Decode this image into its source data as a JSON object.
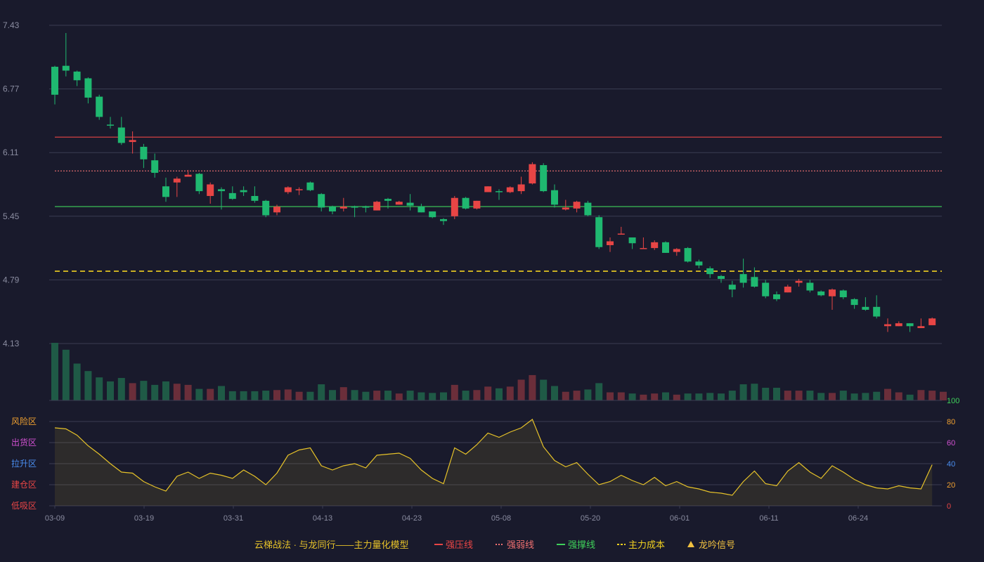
{
  "chart_data": {
    "type": "candlestick",
    "x_labels": [
      "03-09",
      "03-19",
      "03-31",
      "04-13",
      "04-23",
      "05-08",
      "05-20",
      "06-01",
      "06-11",
      "06-24"
    ],
    "price_axis": {
      "ticks": [
        "7.43",
        "6.77",
        "6.11",
        "5.45",
        "4.79",
        "4.13"
      ],
      "range": [
        4.13,
        7.43
      ]
    },
    "levels": [
      {
        "name": "强压线",
        "value": 6.27,
        "color": "#e84545",
        "style": "solid"
      },
      {
        "name": "强弱线",
        "value": 5.92,
        "color": "#f07070",
        "style": "dotted"
      },
      {
        "name": "强撑线",
        "value": 5.55,
        "color": "#3fd15a",
        "style": "solid"
      },
      {
        "name": "主力成本",
        "value": 4.88,
        "color": "#f0d020",
        "style": "dashed"
      }
    ],
    "candles": [
      [
        7.0,
        6.71,
        7.01,
        6.61
      ],
      [
        7.01,
        6.96,
        7.35,
        6.9
      ],
      [
        6.95,
        6.86,
        6.96,
        6.8
      ],
      [
        6.88,
        6.68,
        6.89,
        6.62
      ],
      [
        6.69,
        6.48,
        6.71,
        6.45
      ],
      [
        6.4,
        6.39,
        6.48,
        6.36
      ],
      [
        6.37,
        6.21,
        6.48,
        6.19
      ],
      [
        6.22,
        6.24,
        6.33,
        6.1
      ],
      [
        6.17,
        6.04,
        6.2,
        5.95
      ],
      [
        6.03,
        5.9,
        6.1,
        5.85
      ],
      [
        5.76,
        5.65,
        5.85,
        5.6
      ],
      [
        5.8,
        5.84,
        5.86,
        5.65
      ],
      [
        5.86,
        5.88,
        5.93,
        5.86
      ],
      [
        5.89,
        5.71,
        5.9,
        5.68
      ],
      [
        5.66,
        5.78,
        5.8,
        5.58
      ],
      [
        5.73,
        5.71,
        5.75,
        5.52
      ],
      [
        5.69,
        5.63,
        5.76,
        5.62
      ],
      [
        5.72,
        5.7,
        5.76,
        5.66
      ],
      [
        5.66,
        5.61,
        5.76,
        5.59
      ],
      [
        5.61,
        5.46,
        5.62,
        5.44
      ],
      [
        5.49,
        5.55,
        5.57,
        5.46
      ],
      [
        5.7,
        5.75,
        5.76,
        5.68
      ],
      [
        5.72,
        5.73,
        5.75,
        5.67
      ],
      [
        5.8,
        5.72,
        5.81,
        5.71
      ],
      [
        5.68,
        5.54,
        5.69,
        5.5
      ],
      [
        5.55,
        5.5,
        5.56,
        5.47
      ],
      [
        5.53,
        5.55,
        5.64,
        5.5
      ],
      [
        5.55,
        5.54,
        5.56,
        5.44
      ],
      [
        5.55,
        5.54,
        5.56,
        5.49
      ],
      [
        5.51,
        5.6,
        5.61,
        5.51
      ],
      [
        5.63,
        5.61,
        5.64,
        5.53
      ],
      [
        5.57,
        5.6,
        5.61,
        5.57
      ],
      [
        5.59,
        5.56,
        5.68,
        5.51
      ],
      [
        5.55,
        5.49,
        5.58,
        5.49
      ],
      [
        5.5,
        5.44,
        5.5,
        5.43
      ],
      [
        5.42,
        5.4,
        5.43,
        5.36
      ],
      [
        5.45,
        5.64,
        5.66,
        5.42
      ],
      [
        5.64,
        5.53,
        5.65,
        5.52
      ],
      [
        5.53,
        5.61,
        5.61,
        5.52
      ],
      [
        5.7,
        5.76,
        5.76,
        5.7
      ],
      [
        5.71,
        5.7,
        5.73,
        5.62
      ],
      [
        5.7,
        5.75,
        5.76,
        5.69
      ],
      [
        5.71,
        5.78,
        5.86,
        5.68
      ],
      [
        5.79,
        5.99,
        6.01,
        5.78
      ],
      [
        5.98,
        5.71,
        6.0,
        5.7
      ],
      [
        5.72,
        5.57,
        5.78,
        5.54
      ],
      [
        5.52,
        5.54,
        5.62,
        5.51
      ],
      [
        5.53,
        5.6,
        5.61,
        5.49
      ],
      [
        5.59,
        5.46,
        5.61,
        5.45
      ],
      [
        5.44,
        5.13,
        5.46,
        5.11
      ],
      [
        5.15,
        5.19,
        5.23,
        5.08
      ],
      [
        5.27,
        5.27,
        5.34,
        5.26
      ],
      [
        5.23,
        5.17,
        5.23,
        5.11
      ],
      [
        5.12,
        5.12,
        5.23,
        5.12
      ],
      [
        5.12,
        5.18,
        5.2,
        5.1
      ],
      [
        5.18,
        5.07,
        5.19,
        5.07
      ],
      [
        5.08,
        5.11,
        5.12,
        5.04
      ],
      [
        5.12,
        4.98,
        5.13,
        4.97
      ],
      [
        4.98,
        4.94,
        5.0,
        4.91
      ],
      [
        4.91,
        4.85,
        4.93,
        4.81
      ],
      [
        4.83,
        4.8,
        4.84,
        4.76
      ],
      [
        4.74,
        4.69,
        4.78,
        4.61
      ],
      [
        4.85,
        4.76,
        5.01,
        4.71
      ],
      [
        4.82,
        4.72,
        4.92,
        4.71
      ],
      [
        4.76,
        4.62,
        4.79,
        4.6
      ],
      [
        4.64,
        4.59,
        4.67,
        4.57
      ],
      [
        4.66,
        4.72,
        4.74,
        4.66
      ],
      [
        4.76,
        4.78,
        4.8,
        4.72
      ],
      [
        4.76,
        4.68,
        4.79,
        4.66
      ],
      [
        4.67,
        4.63,
        4.68,
        4.62
      ],
      [
        4.62,
        4.69,
        4.7,
        4.48
      ],
      [
        4.68,
        4.61,
        4.69,
        4.59
      ],
      [
        4.59,
        4.53,
        4.6,
        4.49
      ],
      [
        4.51,
        4.48,
        4.61,
        4.47
      ],
      [
        4.51,
        4.41,
        4.63,
        4.39
      ],
      [
        4.31,
        4.33,
        4.39,
        4.25
      ],
      [
        4.31,
        4.34,
        4.36,
        4.31
      ],
      [
        4.34,
        4.31,
        4.34,
        4.25
      ],
      [
        4.29,
        4.31,
        4.39,
        4.29
      ],
      [
        4.32,
        4.39,
        4.4,
        4.32
      ]
    ],
    "volume": [
      100,
      88,
      64,
      51,
      40,
      33,
      39,
      30,
      34,
      27,
      33,
      29,
      27,
      20,
      20,
      25,
      16,
      16,
      16,
      17,
      18,
      19,
      15,
      15,
      28,
      18,
      23,
      18,
      15,
      17,
      17,
      12,
      17,
      14,
      13,
      14,
      27,
      17,
      18,
      24,
      21,
      24,
      36,
      44,
      36,
      25,
      15,
      17,
      19,
      30,
      14,
      14,
      12,
      10,
      12,
      14,
      10,
      12,
      12,
      13,
      12,
      17,
      28,
      29,
      22,
      22,
      17,
      17,
      17,
      13,
      13,
      17,
      12,
      13,
      15,
      20,
      14,
      10,
      18,
      17,
      15
    ],
    "indicator": {
      "axis_ticks_right": [
        {
          "label": "100",
          "value": 100,
          "color": "#3fd15a"
        },
        {
          "label": "80",
          "value": 80,
          "color": "#f0a030"
        },
        {
          "label": "60",
          "value": 60,
          "color": "#d050d0"
        },
        {
          "label": "40",
          "value": 40,
          "color": "#4a8ef0"
        },
        {
          "label": "20",
          "value": 20,
          "color": "#f0a030"
        },
        {
          "label": "0",
          "value": 0,
          "color": "#e84545"
        }
      ],
      "zones": [
        {
          "label": "风险区",
          "value": 80,
          "color": "#f0a030"
        },
        {
          "label": "出货区",
          "value": 60,
          "color": "#d050d0"
        },
        {
          "label": "拉升区",
          "value": 40,
          "color": "#4a8ef0"
        },
        {
          "label": "建仓区",
          "value": 20,
          "color": "#e84545"
        },
        {
          "label": "低吸区",
          "value": 0,
          "color": "#e84545"
        }
      ],
      "values": [
        74,
        73,
        67,
        57,
        49,
        40,
        32,
        31,
        23,
        18,
        14,
        28,
        32,
        26,
        31,
        29,
        26,
        34,
        28,
        20,
        31,
        48,
        53,
        55,
        38,
        34,
        38,
        40,
        36,
        48,
        49,
        50,
        45,
        34,
        26,
        21,
        55,
        49,
        58,
        69,
        65,
        70,
        74,
        82,
        56,
        43,
        37,
        41,
        30,
        20,
        23,
        29,
        24,
        20,
        27,
        19,
        23,
        18,
        16,
        13,
        12,
        10,
        23,
        33,
        21,
        19,
        33,
        41,
        32,
        26,
        38,
        32,
        25,
        20,
        17,
        16,
        19,
        17,
        16,
        39
      ]
    },
    "legend": {
      "title": "云梯战法 · 与龙同行——主力量化模型",
      "items": [
        {
          "label": "强压线",
          "color": "#e84545",
          "style": "solid"
        },
        {
          "label": "强弱线",
          "color": "#f07070",
          "style": "dotted"
        },
        {
          "label": "强撑线",
          "color": "#3fd15a",
          "style": "solid"
        },
        {
          "label": "主力成本",
          "color": "#f0d020",
          "style": "dashed"
        },
        {
          "label": "龙吟信号",
          "color": "#f0c040",
          "style": "triangle"
        }
      ]
    },
    "colors": {
      "up": "#e84545",
      "down": "#1fb870",
      "grid": "#3a3c52",
      "axis_text": "#8a8ca0",
      "indicator_line": "#e6c229"
    }
  }
}
